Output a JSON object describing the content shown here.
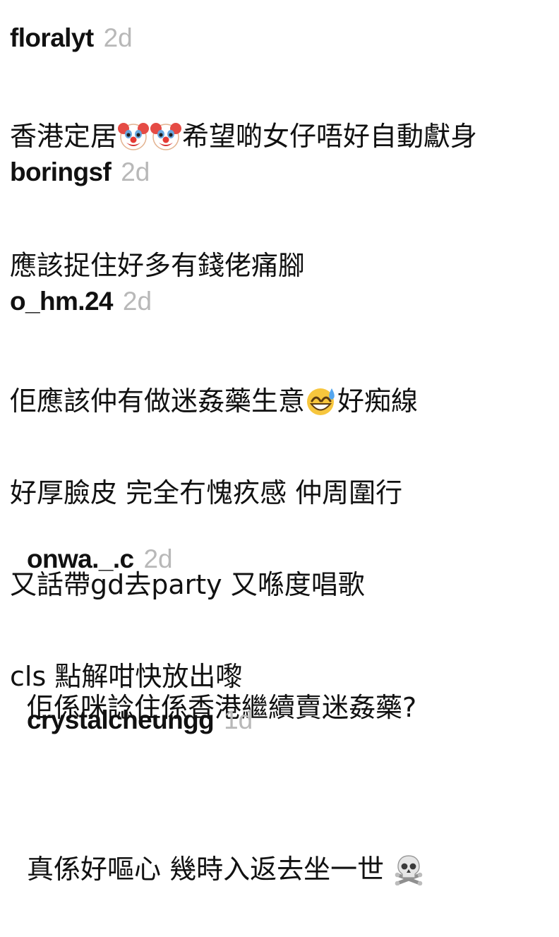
{
  "comments": [
    {
      "username": "floralyt",
      "time": "2d",
      "lines": [
        {
          "before": "香港定居",
          "emojis": [
            "clown-face",
            "clown-face"
          ],
          "after": "希望啲女仔唔好自動獻身"
        }
      ]
    },
    {
      "username": "boringsf",
      "time": "2d",
      "lines": [
        {
          "text": "應該捉住好多有錢佬痛腳"
        }
      ]
    },
    {
      "username": "o_hm.24",
      "time": "2d",
      "lines": [
        {
          "before": "佢應該仲有做迷姦藥生意",
          "emojis": [
            "grinning-sweat-face"
          ],
          "after": "好痴線"
        },
        {
          "text": "好厚臉皮 完全冇愧疚感 仲周圍行"
        },
        {
          "text": "又話帶gd去party 又喺度唱歌"
        },
        {
          "text": "cls 點解咁快放出嚟"
        }
      ]
    },
    {
      "username": "onwa._.c",
      "time": "2d",
      "reply": true,
      "lines": [
        {
          "text": "佢係咪諗住係香港繼續賣迷姦藥?"
        }
      ]
    },
    {
      "username": "crystalcheungg",
      "time": "1d",
      "reply": true,
      "lines": [
        {
          "before": "真係好嘔心 幾時入返去坐一世 ",
          "emojis": [
            "skull-crossbones"
          ],
          "after": ""
        }
      ]
    }
  ]
}
